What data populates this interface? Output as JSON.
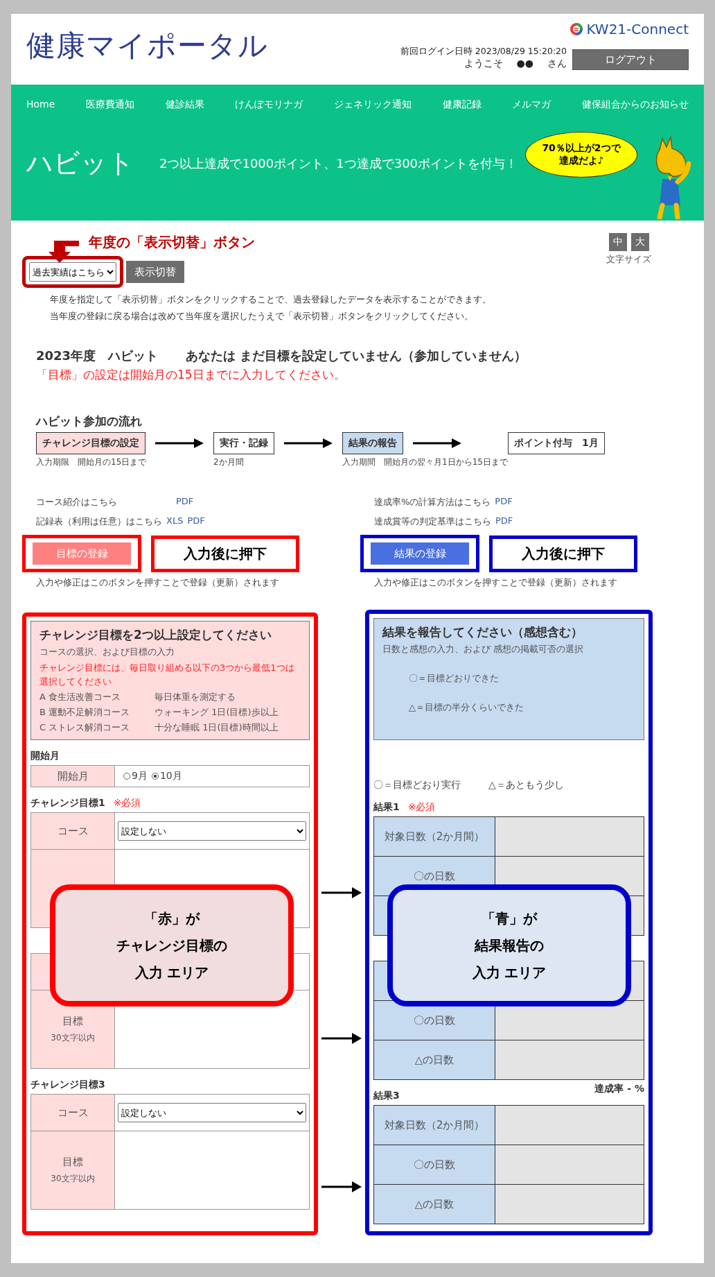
{
  "header": {
    "title": "健康マイポータル",
    "brand": "KW21-Connect",
    "last_login": "前回ログイン日時 2023/08/29 15:20:20",
    "welcome": [
      "ようこそ",
      "●●",
      "さん"
    ],
    "logout": "ログアウト"
  },
  "nav": [
    "Home",
    "医療費通知",
    "健診結果",
    "けんぽモリナガ",
    "ジェネリック通知",
    "健康記録",
    "メルマガ",
    "健保組合からのお知らせ"
  ],
  "banner": {
    "title": "ハビット",
    "subtitle": "2つ以上達成で1000ポイント、1つ達成で300ポイントを付与！",
    "bubble": [
      "70％以上が2つで",
      "達成だよ♪"
    ]
  },
  "annotation": "年度の「表示切替」ボタン",
  "year_select": {
    "value": "過去実績はこちら"
  },
  "switch_button": "表示切替",
  "font_size": {
    "buttons": [
      "中",
      "大"
    ],
    "label": "文字サイズ"
  },
  "help": [
    "年度を指定して「表示切替」ボタンをクリックすることで、過去登録したデータを表示することができます。",
    "当年度の登録に戻る場合は改めて当年度を選択したうえで「表示切替」ボタンをクリックしてください。"
  ],
  "status": {
    "year": "2023年度　ハビット",
    "message": "あなたは まだ目標を設定していません（参加していません）",
    "deadline": "「目標」の設定は開始月の15日までに入力してください。"
  },
  "flow": {
    "title": "ハビット参加の流れ",
    "steps": [
      {
        "label": "チャレンジ目標の設定",
        "note": "入力期限　開始月の15日まで",
        "kind": "goal"
      },
      {
        "label": "実行・記録",
        "note": "2か月間",
        "kind": "plain"
      },
      {
        "label": "結果の報告",
        "note": "入力期間　開始月の翌々月1日から15日まで",
        "kind": "result"
      },
      {
        "label": "ポイント付与　1月",
        "kind": "plain"
      }
    ]
  },
  "left": {
    "links": [
      {
        "text": "コース紹介はこちら",
        "links": [
          "PDF"
        ]
      },
      {
        "text": "記録表（利用は任意）はこちら",
        "links": [
          "XLS",
          "PDF"
        ]
      }
    ],
    "button": "目標の登録",
    "callout": "入力後に押下",
    "note": "入力や修正はこのボタンを押すことで登録（更新）されます",
    "card": {
      "title": "チャレンジ目標を2つ以上設定してください",
      "subtitle": "コースの選択、および目標の入力",
      "warning": "チャレンジ目標には、毎日取り組める以下の3つから最低1つは選択してください",
      "courses": [
        [
          "A 食生活改善コース",
          "毎日体重を測定する"
        ],
        [
          "B 運動不足解消コース",
          "ウォーキング 1日(目標)歩以上"
        ],
        [
          "C ストレス解消コース",
          "十分な睡眠 1日(目標)時間以上"
        ]
      ]
    },
    "start_month": {
      "heading": "開始月",
      "label": "開始月",
      "options": [
        {
          "label": "9月",
          "selected": false
        },
        {
          "label": "10月",
          "selected": true
        }
      ]
    },
    "goals": [
      {
        "heading": "チャレンジ目標1",
        "required": "※必須",
        "course_label": "コース",
        "course_value": "設定しない"
      },
      {
        "goal_label": "目標",
        "goal_note": "30文字以内"
      },
      {
        "heading": "チャレンジ目標3",
        "course_label": "コース",
        "course_value": "設定しない",
        "goal_label": "目標",
        "goal_note": "30文字以内"
      }
    ]
  },
  "right": {
    "links": [
      {
        "text": "達成率%の計算方法はこちら",
        "links": [
          "PDF"
        ]
      },
      {
        "text": "達成賞等の判定基準はこちら",
        "links": [
          "PDF"
        ]
      }
    ],
    "button": "結果の登録",
    "callout": "入力後に押下",
    "note": "入力や修正はこのボタンを押すことで登録（更新）されます",
    "card": {
      "title": "結果を報告してください（感想含む）",
      "subtitle": "日数と感想の入力、および 感想の掲載可否の選択",
      "legend": [
        "〇＝目標どおりできた",
        "△＝目標の半分くらいできた"
      ]
    },
    "legend": [
      "〇＝目標どおり実行",
      "△＝あともう少し"
    ],
    "results": [
      {
        "heading": "結果1",
        "required": "※必須",
        "rows": [
          "対象日数（2か月間）",
          "〇の日数",
          null
        ]
      },
      {
        "rows": [
          null,
          "〇の日数",
          "△の日数"
        ]
      },
      {
        "heading": "結果3",
        "rate": "達成率 - %",
        "rows": [
          "対象日数（2か月間）",
          "〇の日数",
          "△の日数"
        ]
      }
    ]
  },
  "overlays": [
    {
      "lines": [
        "「赤」が",
        "チャレンジ目標の",
        "入力 エリア"
      ],
      "color": "#ff0000"
    },
    {
      "lines": [
        "「青」が",
        "結果報告の",
        "入力 エリア"
      ],
      "color": "#0000cc"
    }
  ]
}
